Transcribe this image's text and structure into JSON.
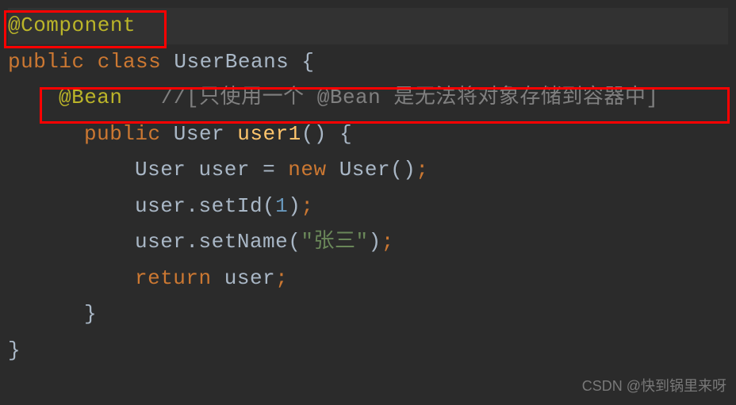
{
  "code": {
    "line1": {
      "annotation": "@Component"
    },
    "line2": {
      "keyword1": "public",
      "keyword2": "class",
      "className": "UserBeans",
      "brace": "{"
    },
    "line3": {
      "annotation": "@Bean",
      "commentPrefix": "//[只使用一个 ",
      "commentAnnotation": "@Bean",
      "commentSuffix": " 是无法将对象存储到容器中]"
    },
    "line4": {
      "keyword": "public",
      "returnType": "User",
      "methodName": "user1",
      "parens": "()",
      "brace": "{"
    },
    "line5": {
      "type": "User",
      "varName": "user",
      "equals": "=",
      "keyword": "new",
      "constructor": "User",
      "parens": "()",
      "semi": ";"
    },
    "line6": {
      "obj": "user",
      "dot": ".",
      "method": "setId",
      "openParen": "(",
      "arg": "1",
      "closeParen": ")",
      "semi": ";"
    },
    "line7": {
      "obj": "user",
      "dot": ".",
      "method": "setName",
      "openParen": "(",
      "arg": "\"张三\"",
      "closeParen": ")",
      "semi": ";"
    },
    "line8": {
      "keyword": "return",
      "varName": "user",
      "semi": ";"
    },
    "line9": {
      "brace": "}"
    },
    "line10": {
      "brace": "}"
    }
  },
  "watermark": "CSDN @快到锅里来呀"
}
